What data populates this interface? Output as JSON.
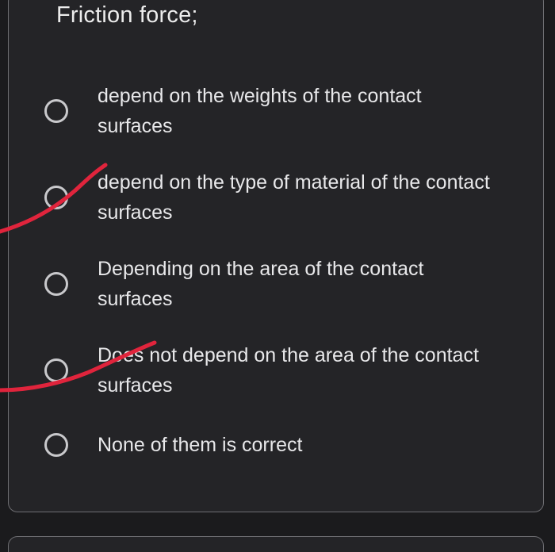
{
  "question": {
    "title": "Friction force;"
  },
  "options": [
    {
      "label": "depend on the weights of the contact surfaces",
      "selected": false
    },
    {
      "label": "depend on the type of material of the contact surfaces",
      "selected": false
    },
    {
      "label": "Depending on the area of the contact surfaces",
      "selected": false
    },
    {
      "label": "Does not depend on the area of the contact surfaces",
      "selected": false
    },
    {
      "label": "None of them is correct",
      "selected": false
    }
  ],
  "colors": {
    "background": "#1b1b1d",
    "card": "#242427",
    "text": "#e8e8ea",
    "annotation": "#e0243c"
  }
}
